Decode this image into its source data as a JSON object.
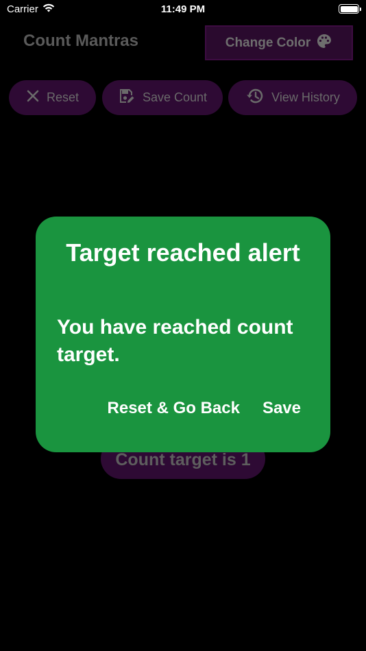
{
  "status_bar": {
    "carrier": "Carrier",
    "time": "11:49 PM",
    "wifi_icon": "wifi-icon",
    "battery_icon": "battery-icon"
  },
  "header": {
    "title": "Count Mantras",
    "change_color_label": "Change Color",
    "change_color_icon": "palette-icon"
  },
  "toolbar": {
    "reset_label": "Reset",
    "reset_icon": "close-icon",
    "save_label": "Save Count",
    "save_icon": "save-edit-icon",
    "history_label": "View History",
    "history_icon": "history-icon"
  },
  "main": {
    "count_target_label": "Count target is 1"
  },
  "dialog": {
    "title": "Target reached alert",
    "message": "You have reached count target.",
    "reset_button_label": "Reset & Go Back",
    "save_button_label": "Save"
  },
  "colors": {
    "background": "#000000",
    "accent_purple": "#2e0a34",
    "dialog_green": "#1a943f",
    "muted_text": "#6a6a6a"
  }
}
